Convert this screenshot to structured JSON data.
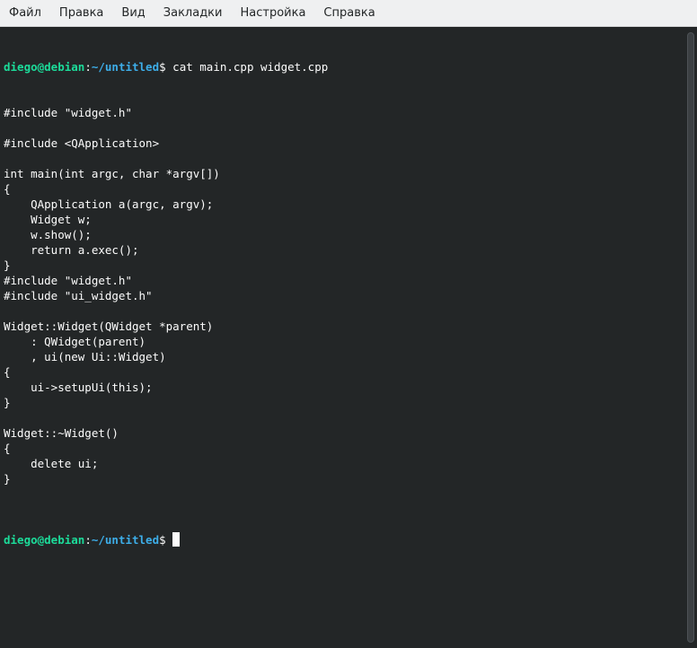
{
  "menu": {
    "items": [
      "Файл",
      "Правка",
      "Вид",
      "Закладки",
      "Настройка",
      "Справка"
    ]
  },
  "prompt": {
    "user_host": "diego@debian",
    "colon": ":",
    "path": "~/untitled",
    "dollar": "$"
  },
  "terminal": {
    "command": " cat main.cpp widget.cpp",
    "output_lines": [
      "#include \"widget.h\"",
      "",
      "#include <QApplication>",
      "",
      "int main(int argc, char *argv[])",
      "{",
      "    QApplication a(argc, argv);",
      "    Widget w;",
      "    w.show();",
      "    return a.exec();",
      "}",
      "#include \"widget.h\"",
      "#include \"ui_widget.h\"",
      "",
      "Widget::Widget(QWidget *parent)",
      "    : QWidget(parent)",
      "    , ui(new Ui::Widget)",
      "{",
      "    ui->setupUi(this);",
      "}",
      "",
      "Widget::~Widget()",
      "{",
      "    delete ui;",
      "}",
      ""
    ],
    "final_prompt_suffix": " "
  },
  "colors": {
    "background": "#232627",
    "foreground": "#fcfcfc",
    "prompt_user": "#1cdc9a",
    "prompt_path": "#3daee9",
    "menubar": "#eff0f1"
  }
}
